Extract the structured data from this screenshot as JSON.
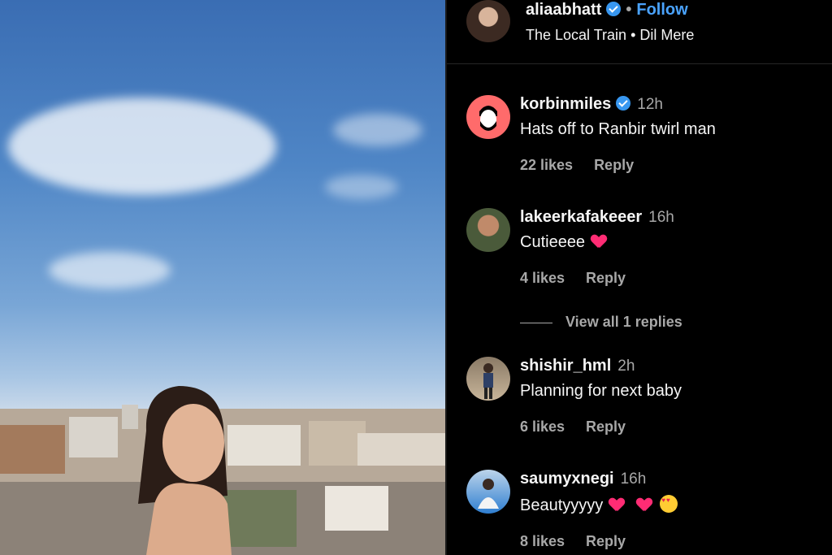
{
  "post": {
    "author": "aliaabhatt",
    "follow_label": "Follow",
    "audio": "The Local Train • Dil Mere",
    "separator": "•"
  },
  "comments": [
    {
      "user": "korbinmiles",
      "verified": true,
      "time": "12h",
      "text": "Hats off to Ranbir twirl man",
      "likes": "22 likes",
      "reply": "Reply"
    },
    {
      "user": "lakeerkafakeeer",
      "verified": false,
      "time": "16h",
      "text": "Cutieeee",
      "emojis": [
        "heart"
      ],
      "likes": "4 likes",
      "reply": "Reply",
      "view_replies": "View all 1 replies"
    },
    {
      "user": "shishir_hml",
      "verified": false,
      "time": "2h",
      "text": "Planning for next baby",
      "likes": "6 likes",
      "reply": "Reply"
    },
    {
      "user": "saumyxnegi",
      "verified": false,
      "time": "16h",
      "text": "Beautyyyyy",
      "emojis": [
        "heart",
        "heart",
        "heart-eyes"
      ],
      "likes": "8 likes",
      "reply": "Reply"
    }
  ],
  "colors": {
    "accent": "#4aa3ff",
    "verified": "#3897f0",
    "heart": "#ff2c74",
    "background": "#000000",
    "muted": "#a8a8a8"
  }
}
